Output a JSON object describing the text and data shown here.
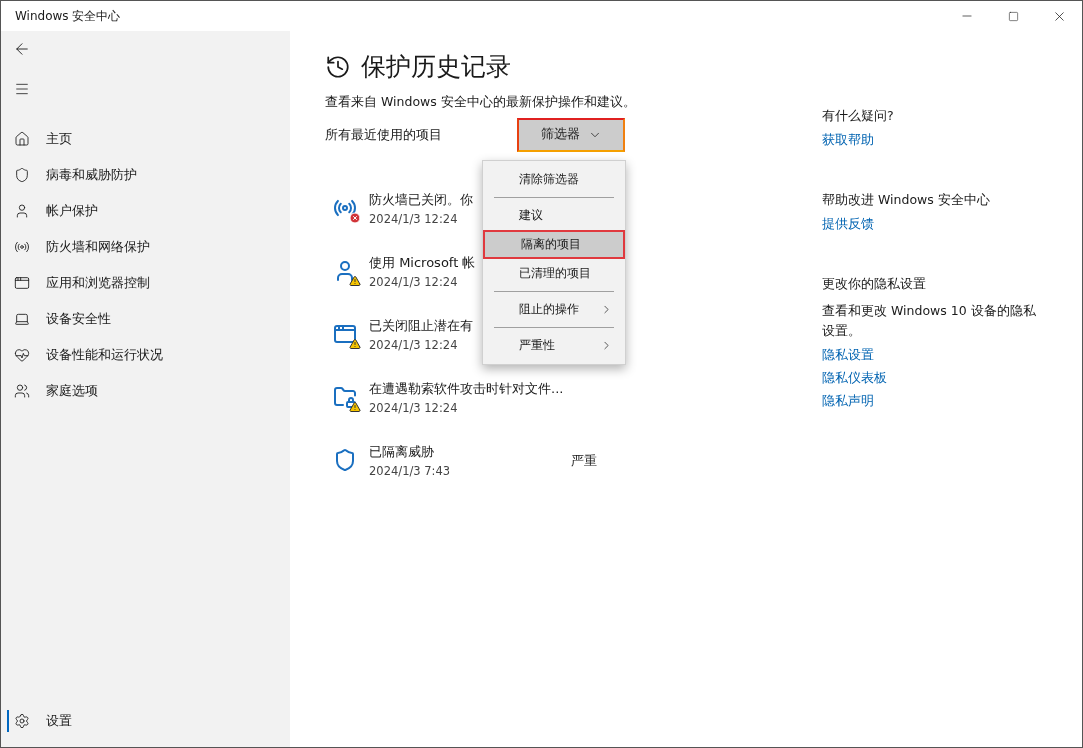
{
  "window": {
    "title": "Windows 安全中心"
  },
  "sidebar": {
    "items": [
      {
        "label": "主页",
        "kind": "home",
        "selected": false
      },
      {
        "label": "病毒和威胁防护",
        "kind": "shield",
        "selected": false
      },
      {
        "label": "帐户保护",
        "kind": "user",
        "selected": false
      },
      {
        "label": "防火墙和网络保护",
        "kind": "antenna",
        "selected": false
      },
      {
        "label": "应用和浏览器控制",
        "kind": "window",
        "selected": false
      },
      {
        "label": "设备安全性",
        "kind": "laptop",
        "selected": false
      },
      {
        "label": "设备性能和运行状况",
        "kind": "heart",
        "selected": false
      },
      {
        "label": "家庭选项",
        "kind": "family",
        "selected": false
      }
    ],
    "settings": {
      "label": "设置",
      "selected": true
    }
  },
  "page": {
    "title": "保护历史记录",
    "subtitle": "查看来自 Windows 安全中心的最新保护操作和建议。",
    "list_label": "所有最近使用的项目",
    "filter": {
      "label": "筛选器",
      "highlighted": true
    },
    "history": [
      {
        "kind": "firewall",
        "title": "防火墙已关闭。你",
        "time": "2024/1/3 12:24"
      },
      {
        "kind": "account",
        "title": "使用 Microsoft 帐",
        "time": "2024/1/3 12:24"
      },
      {
        "kind": "app",
        "title": "已关闭阻止潜在有",
        "time": "2024/1/3 12:24"
      },
      {
        "kind": "ransomware",
        "title": "在遭遇勒索软件攻击时针对文件...",
        "time": "2024/1/3 12:24"
      },
      {
        "kind": "threat",
        "title": "已隔离威胁",
        "time": "2024/1/3 7:43",
        "severity": "严重"
      }
    ],
    "menu": [
      {
        "label": "清除筛选器",
        "kind": "item",
        "selected": false,
        "divider_after": true
      },
      {
        "label": "建议",
        "kind": "item",
        "selected": false,
        "divider_after": false
      },
      {
        "label": "隔离的项目",
        "kind": "item",
        "selected": true,
        "divider_after": false
      },
      {
        "label": "已清理的项目",
        "kind": "item",
        "selected": false,
        "divider_after": true
      },
      {
        "label": "阻止的操作",
        "kind": "submenu",
        "selected": false,
        "divider_after": true
      },
      {
        "label": "严重性",
        "kind": "submenu",
        "selected": false,
        "divider_after": false
      }
    ]
  },
  "aside": [
    {
      "heading": "有什么疑问?",
      "links": [
        "获取帮助"
      ]
    },
    {
      "heading": "帮助改进 Windows 安全中心",
      "links": [
        "提供反馈"
      ]
    },
    {
      "heading": "更改你的隐私设置",
      "text": "查看和更改 Windows 10 设备的隐私设置。",
      "links": [
        "隐私设置",
        "隐私仪表板",
        "隐私声明"
      ]
    }
  ]
}
